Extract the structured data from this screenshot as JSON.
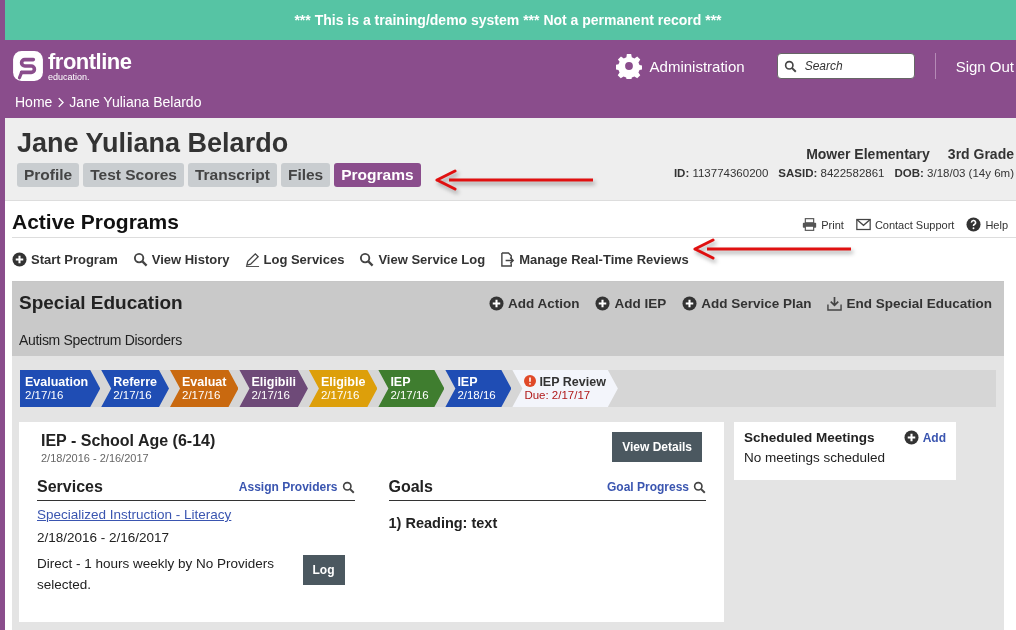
{
  "banner": "*** This is a training/demo system *** Not a permanent record ***",
  "header": {
    "logo_name": "frontline",
    "logo_sub": "education.",
    "admin": "Administration",
    "search": {
      "placeholder": "Search"
    },
    "sign_out": "Sign Out"
  },
  "breadcrumb": [
    "Home",
    "Jane Yuliana Belardo"
  ],
  "student": {
    "name": "Jane Yuliana Belardo",
    "school": "Mower Elementary",
    "grade": "3rd Grade",
    "ids": [
      {
        "label": "ID:",
        "value": "113774360200"
      },
      {
        "label": "SASID:",
        "value": "8422582861"
      },
      {
        "label": "DOB:",
        "value": "3/18/03 (14y 6m)"
      }
    ]
  },
  "tabs": [
    {
      "label": "Profile",
      "selected": false
    },
    {
      "label": "Test Scores",
      "selected": false
    },
    {
      "label": "Transcript",
      "selected": false
    },
    {
      "label": "Files",
      "selected": false
    },
    {
      "label": "Programs",
      "selected": true
    }
  ],
  "page_title": "Active Programs",
  "utility_links": [
    {
      "label": "Print",
      "kind": "print"
    },
    {
      "label": "Contact Support",
      "kind": "mail"
    },
    {
      "label": "Help",
      "kind": "help"
    }
  ],
  "actions": [
    {
      "label": "Start Program",
      "kind": "plus"
    },
    {
      "label": "View History",
      "kind": "search"
    },
    {
      "label": "Log Services",
      "kind": "pencil"
    },
    {
      "label": "View Service Log",
      "kind": "search"
    },
    {
      "label": "Manage Real-Time Reviews",
      "kind": "export"
    }
  ],
  "program": {
    "title": "Special Education",
    "subtitle": "Autism Spectrum Disorders",
    "actions": [
      {
        "label": "Add Action",
        "kind": "plus"
      },
      {
        "label": "Add IEP",
        "kind": "plus"
      },
      {
        "label": "Add Service Plan",
        "kind": "plus"
      },
      {
        "label": "End Special Education",
        "kind": "download"
      }
    ],
    "steps": [
      {
        "kind": "done",
        "label": "Evaluation",
        "date": "2/17/16",
        "color": "#1f4db4"
      },
      {
        "kind": "done",
        "label": "Referre",
        "date": "2/17/16",
        "color": "#1f4db4"
      },
      {
        "kind": "done",
        "label": "Evaluat",
        "date": "2/17/16",
        "color": "#c9690f"
      },
      {
        "kind": "done",
        "label": "Eligibili",
        "date": "2/17/16",
        "color": "#6e4a78"
      },
      {
        "kind": "done",
        "label": "Eligible",
        "date": "2/17/16",
        "color": "#dd9f0a"
      },
      {
        "kind": "done",
        "label": "IEP",
        "date": "2/17/16",
        "color": "#3f7d2f"
      },
      {
        "kind": "done",
        "label": "IEP",
        "date": "2/18/16",
        "color": "#1f4db4"
      },
      {
        "kind": "due",
        "label": "IEP Review",
        "date": "Due: 2/17/17"
      }
    ],
    "iep": {
      "title": "IEP - School Age (6-14)",
      "dates": "2/18/2016 - 2/16/2017",
      "button": "View Details",
      "services": {
        "heading": "Services",
        "link": "Assign Providers",
        "service": "Specialized Instruction - Literacy",
        "dates": "2/18/2016 - 2/16/2017",
        "detail": "Direct - 1 hours weekly by No Providers selected.",
        "button": "Log"
      },
      "goals": {
        "heading": "Goals",
        "link": "Goal Progress",
        "items": [
          "1) Reading: text"
        ]
      }
    },
    "meetings": {
      "title": "Scheduled Meetings",
      "add": "Add",
      "empty": "No meetings scheduled"
    }
  }
}
